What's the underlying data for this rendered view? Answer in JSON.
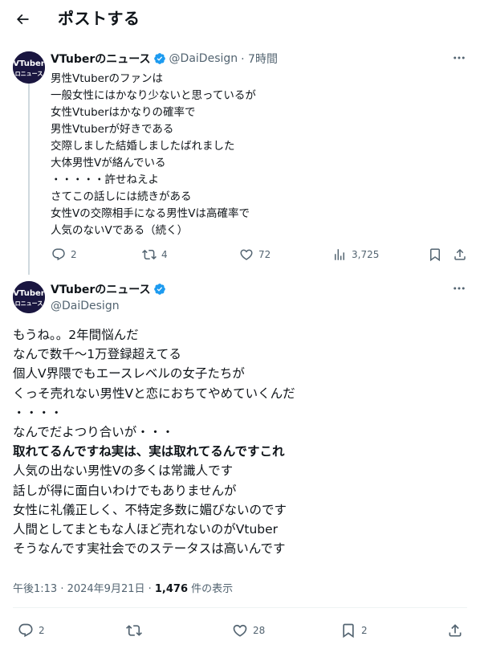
{
  "header": {
    "title": "ポストする"
  },
  "reply": {
    "display_name": "VTuberのニュース",
    "handle": "@DaiDesign",
    "time": "· 7時間",
    "avatar_text": [
      "VTuber",
      "ロニュース"
    ],
    "lines": [
      "男性Vtuberのファンは",
      "一般女性にはかなり少ないと思っているが",
      "女性Vtuberはかなりの確率で",
      "男性Vtuberが好きである",
      "交際しました結婚しましたばれました",
      "大体男性Vが絡んでいる",
      "・・・・・許せねえよ",
      "さてこの話しには続きがある",
      "女性Vの交際相手になる男性Vは高確率で",
      "人気のないVである（続く）"
    ],
    "stats": {
      "replies": "2",
      "reposts": "4",
      "likes": "72",
      "views": "3,725"
    }
  },
  "post": {
    "display_name": "VTuberのニュース",
    "handle": "@DaiDesign",
    "lines": [
      {
        "text": "もうね。。2年間悩んだ",
        "bold": false
      },
      {
        "text": "なんで数千〜1万登録超えてる",
        "bold": false
      },
      {
        "text": "個人V界隈でもエースレベルの女子たちが",
        "bold": false
      },
      {
        "text": "くっそ売れない男性Vと恋におちてやめていくんだ",
        "bold": false
      },
      {
        "text": "・・・・",
        "bold": false
      },
      {
        "text": "なんでだよつり合いが・・・",
        "bold": false
      },
      {
        "text": "取れてるんですね実は、実は取れてるんですこれ",
        "bold": true
      },
      {
        "text": "人気の出ない男性Vの多くは常識人です",
        "bold": false
      },
      {
        "text": "話しが得に面白いわけでもありませんが",
        "bold": false
      },
      {
        "text": "女性に礼儀正しく、不特定多数に媚びないのです",
        "bold": false
      },
      {
        "text": "人間としてまともな人ほど売れないのがVtuber",
        "bold": false
      },
      {
        "text": "そうなんです実社会でのステータスは高いんです",
        "bold": false
      }
    ],
    "meta": {
      "time": "午後1:13 · 2024年9月21日 · ",
      "views": "1,476",
      "views_label": " 件の表示"
    },
    "stats": {
      "replies": "2",
      "likes": "28",
      "bookmarks": "2"
    }
  },
  "colors": {
    "text": "#0f1419",
    "secondary": "#536471",
    "verified": "#1d9bf0",
    "line": "#cfd9de",
    "avatar_bg": "#1a1640"
  },
  "icons": [
    "back-arrow-icon",
    "verified-badge-icon",
    "more-icon",
    "reply-icon",
    "repost-icon",
    "like-icon",
    "views-icon",
    "bookmark-icon",
    "share-icon"
  ]
}
